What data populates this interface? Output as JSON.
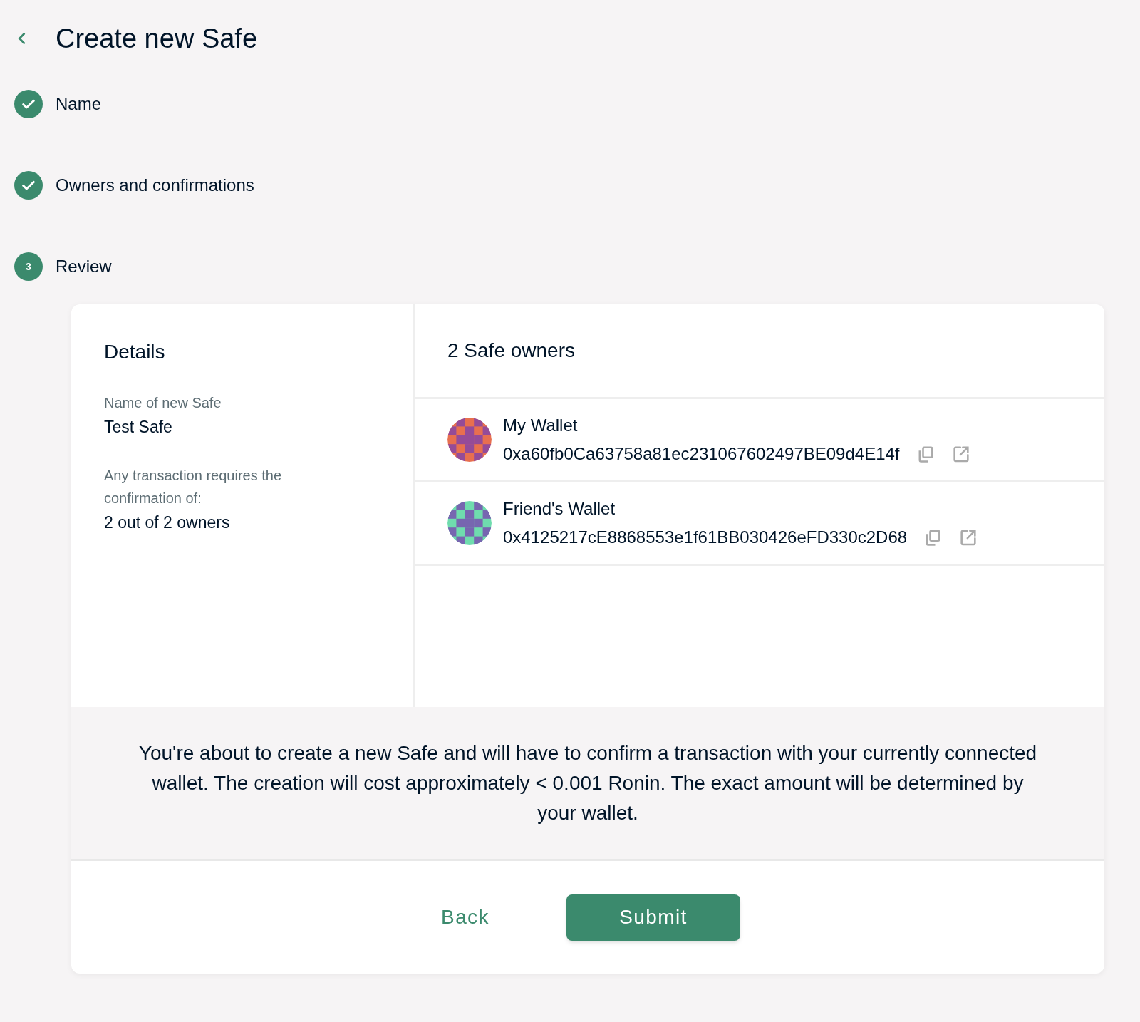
{
  "header": {
    "title": "Create new Safe"
  },
  "steps": [
    {
      "label": "Name",
      "completed": true
    },
    {
      "label": "Owners and confirmations",
      "completed": true
    },
    {
      "label": "Review",
      "completed": false,
      "number": "3"
    }
  ],
  "details": {
    "heading": "Details",
    "fields": [
      {
        "label": "Name of new Safe",
        "value": "Test Safe"
      },
      {
        "label": "Any transaction requires the confirmation of:",
        "value": "2 out of 2 owners"
      }
    ]
  },
  "owners": {
    "heading": "2 Safe owners",
    "items": [
      {
        "name": "My Wallet",
        "address": "0xa60fb0Ca63758a81ec231067602497BE09d4E14f",
        "color": "#e86f4f"
      },
      {
        "name": "Friend's Wallet",
        "address": "0x4125217cE8868553e1f61BB030426eFD330c2D68",
        "color": "#6fdcae"
      }
    ]
  },
  "notice": "You're about to create a new Safe and will have to confirm a transaction with your currently connected wallet. The creation will cost approximately < 0.001 Ronin. The exact amount will be determined by your wallet.",
  "buttons": [
    {
      "label": "Back",
      "kind": "text"
    },
    {
      "label": "Submit",
      "kind": "primary"
    }
  ]
}
